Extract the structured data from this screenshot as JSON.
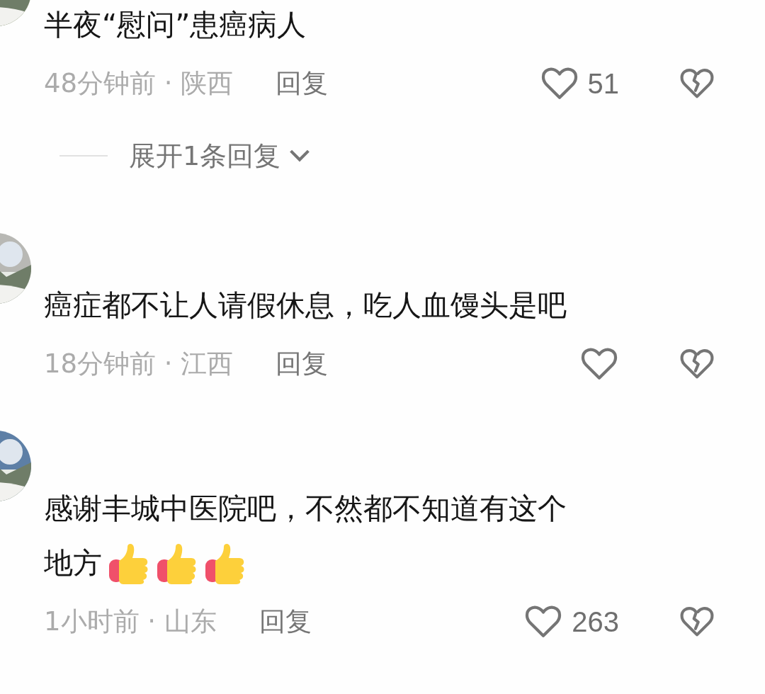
{
  "comments": [
    {
      "avatar": {
        "kind": "picture"
      },
      "text_lines": [
        "半夜“慰问”患癌病人"
      ],
      "time_location": "48分钟前 · 陕西",
      "reply": "回复",
      "likes": "51",
      "liked": false,
      "disliked": false,
      "expand_replies": "展开1条回复"
    },
    {
      "avatar": {
        "kind": "picture"
      },
      "text_lines": [
        "癌症都不让人请假休息，吃人血馒头是吧"
      ],
      "time_location": "18分钟前 · 江西",
      "reply": "回复",
      "liked": false,
      "disliked": false
    },
    {
      "avatar": {
        "kind": "picture"
      },
      "text_lines": [
        "感谢丰城中医院吧，不然都不知道有这个",
        "地方"
      ],
      "emojis": [
        {
          "kind": "thumbs_up"
        },
        {
          "kind": "thumbs_up"
        },
        {
          "kind": "thumbs_up"
        }
      ],
      "time_location": "1小时前 · 山东",
      "reply": "回复",
      "likes": "263",
      "liked": false,
      "disliked": false
    }
  ]
}
